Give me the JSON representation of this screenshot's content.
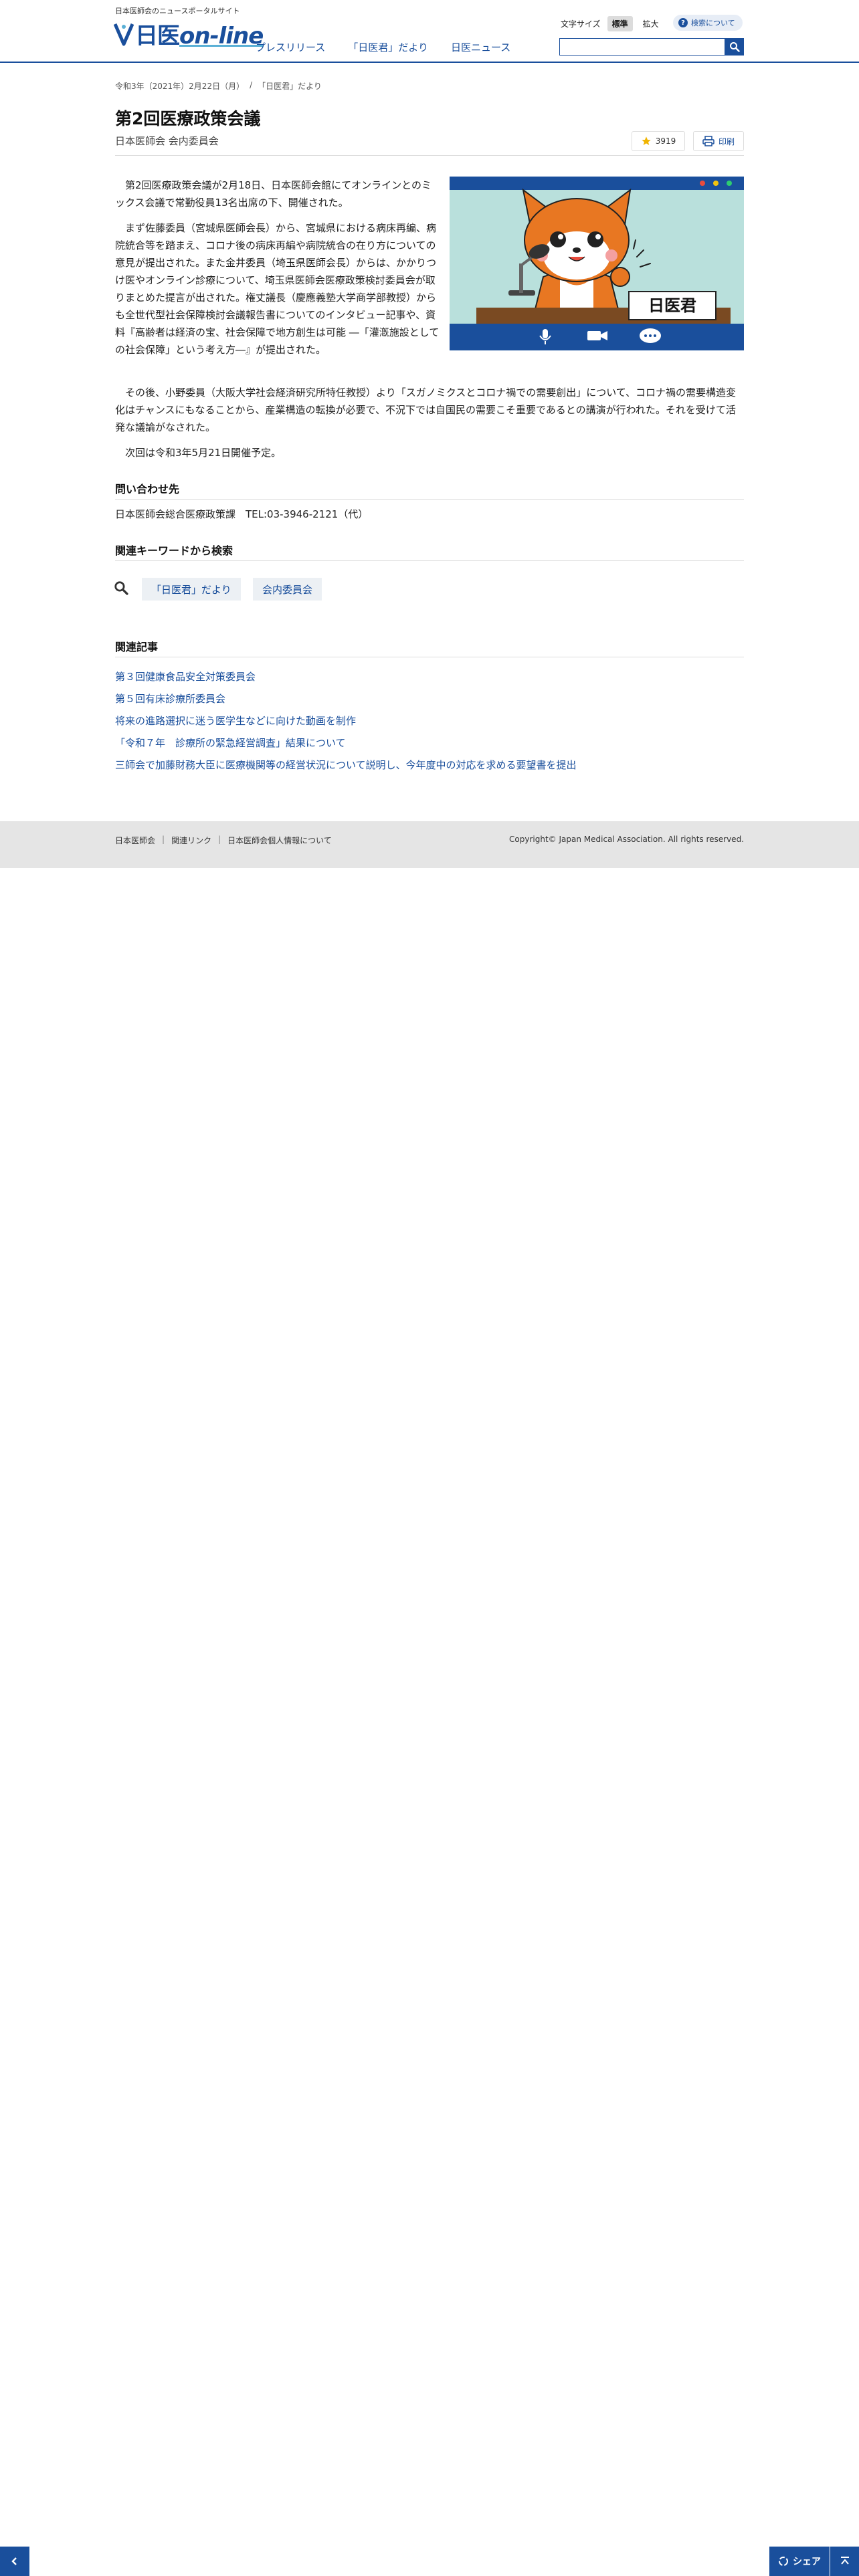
{
  "header": {
    "tagline": "日本医師会のニュースポータルサイト",
    "logo_prefix": "日医",
    "logo_suffix": "on-line",
    "nav": [
      "プレスリリース",
      "「日医君」だより",
      "日医ニュース"
    ],
    "font_size_label": "文字サイズ",
    "font_size_normal": "標準",
    "font_size_large": "拡大",
    "search_about": "検索について",
    "search_placeholder": ""
  },
  "breadcrumb": [
    "令和3年（2021年）2月22日（月）",
    "/",
    "「日医君」だより"
  ],
  "article": {
    "title": "第2回医療政策会議",
    "subtitle": "日本医師会 会内委員会",
    "favorite_count": "3919",
    "print_label": "印刷",
    "p1": "第2回医療政策会議が2月18日、日本医師会館にてオンラインとのミックス会議で常勤役員13名出席の下、開催された。",
    "p2": "まず佐藤委員（宮城県医師会長）から、宮城県における病床再編、病院統合等を踏まえ、コロナ後の病床再編や病院統合の在り方についての意見が提出された。また金井委員（埼玉県医師会長）からは、かかりつけ医やオンライン診療について、埼玉県医師会医療政策検討委員会が取りまとめた提言が出された。権丈議長（慶應義塾大学商学部教授）からも全世代型社会保障検討会議報告書についてのインタビュー記事や、資料『高齢者は経済の宝、社会保障で地方創生は可能 ―「灌漑施設としての社会保障」という考え方―』が提出された。",
    "p3": "その後、小野委員（大阪大学社会経済研究所特任教授）より「スガノミクスとコロナ禍での需要創出」について、コロナ禍の需要構造変化はチャンスにもなることから、産業構造の転換が必要で、不況下では自国民の需要こそ重要であるとの講演が行われた。それを受けて活発な議論がなされた。",
    "p4": "次回は令和3年5月21日開催予定。",
    "illustration_sign": "日医君"
  },
  "contact": {
    "heading": "問い合わせ先",
    "text": "日本医師会総合医療政策課　TEL:03-3946-2121（代）"
  },
  "keywords": {
    "heading": "関連キーワードから検索",
    "items": [
      "「日医君」だより",
      "会内委員会"
    ]
  },
  "related": {
    "heading": "関連記事",
    "items": [
      "第３回健康食品安全対策委員会",
      "第５回有床診療所委員会",
      "将来の進路選択に迷う医学生などに向けた動画を制作",
      "「令和７年　診療所の緊急経営調査」結果について",
      "三師会で加藤財務大臣に医療機関等の経営状況について説明し、今年度中の対応を求める要望書を提出"
    ]
  },
  "footer": {
    "links": [
      "日本医師会",
      "関連リンク",
      "日本医師会個人情報について"
    ],
    "copyright": "Copyright© Japan Medical Association. All rights reserved."
  },
  "floating": {
    "share_label": "シェア"
  },
  "colors": {
    "brand": "#1a4f9c",
    "illustration_bg": "#b9e0dc",
    "mascot_orange": "#e87722"
  }
}
